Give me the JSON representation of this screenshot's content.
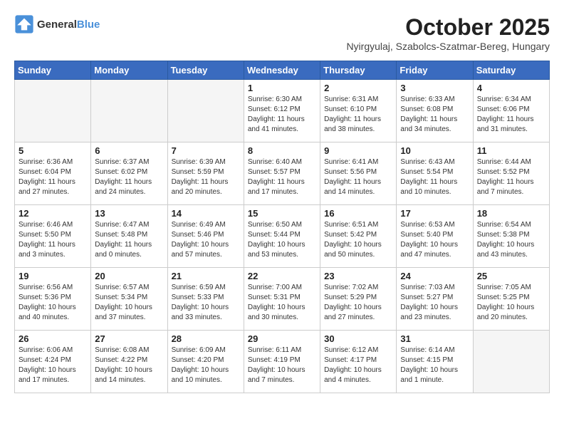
{
  "header": {
    "logo_line1": "General",
    "logo_line2": "Blue",
    "month_title": "October 2025",
    "subtitle": "Nyirgyulaj, Szabolcs-Szatmar-Bereg, Hungary"
  },
  "weekdays": [
    "Sunday",
    "Monday",
    "Tuesday",
    "Wednesday",
    "Thursday",
    "Friday",
    "Saturday"
  ],
  "weeks": [
    [
      {
        "day": "",
        "info": ""
      },
      {
        "day": "",
        "info": ""
      },
      {
        "day": "",
        "info": ""
      },
      {
        "day": "1",
        "info": "Sunrise: 6:30 AM\nSunset: 6:12 PM\nDaylight: 11 hours\nand 41 minutes."
      },
      {
        "day": "2",
        "info": "Sunrise: 6:31 AM\nSunset: 6:10 PM\nDaylight: 11 hours\nand 38 minutes."
      },
      {
        "day": "3",
        "info": "Sunrise: 6:33 AM\nSunset: 6:08 PM\nDaylight: 11 hours\nand 34 minutes."
      },
      {
        "day": "4",
        "info": "Sunrise: 6:34 AM\nSunset: 6:06 PM\nDaylight: 11 hours\nand 31 minutes."
      }
    ],
    [
      {
        "day": "5",
        "info": "Sunrise: 6:36 AM\nSunset: 6:04 PM\nDaylight: 11 hours\nand 27 minutes."
      },
      {
        "day": "6",
        "info": "Sunrise: 6:37 AM\nSunset: 6:02 PM\nDaylight: 11 hours\nand 24 minutes."
      },
      {
        "day": "7",
        "info": "Sunrise: 6:39 AM\nSunset: 5:59 PM\nDaylight: 11 hours\nand 20 minutes."
      },
      {
        "day": "8",
        "info": "Sunrise: 6:40 AM\nSunset: 5:57 PM\nDaylight: 11 hours\nand 17 minutes."
      },
      {
        "day": "9",
        "info": "Sunrise: 6:41 AM\nSunset: 5:56 PM\nDaylight: 11 hours\nand 14 minutes."
      },
      {
        "day": "10",
        "info": "Sunrise: 6:43 AM\nSunset: 5:54 PM\nDaylight: 11 hours\nand 10 minutes."
      },
      {
        "day": "11",
        "info": "Sunrise: 6:44 AM\nSunset: 5:52 PM\nDaylight: 11 hours\nand 7 minutes."
      }
    ],
    [
      {
        "day": "12",
        "info": "Sunrise: 6:46 AM\nSunset: 5:50 PM\nDaylight: 11 hours\nand 3 minutes."
      },
      {
        "day": "13",
        "info": "Sunrise: 6:47 AM\nSunset: 5:48 PM\nDaylight: 11 hours\nand 0 minutes."
      },
      {
        "day": "14",
        "info": "Sunrise: 6:49 AM\nSunset: 5:46 PM\nDaylight: 10 hours\nand 57 minutes."
      },
      {
        "day": "15",
        "info": "Sunrise: 6:50 AM\nSunset: 5:44 PM\nDaylight: 10 hours\nand 53 minutes."
      },
      {
        "day": "16",
        "info": "Sunrise: 6:51 AM\nSunset: 5:42 PM\nDaylight: 10 hours\nand 50 minutes."
      },
      {
        "day": "17",
        "info": "Sunrise: 6:53 AM\nSunset: 5:40 PM\nDaylight: 10 hours\nand 47 minutes."
      },
      {
        "day": "18",
        "info": "Sunrise: 6:54 AM\nSunset: 5:38 PM\nDaylight: 10 hours\nand 43 minutes."
      }
    ],
    [
      {
        "day": "19",
        "info": "Sunrise: 6:56 AM\nSunset: 5:36 PM\nDaylight: 10 hours\nand 40 minutes."
      },
      {
        "day": "20",
        "info": "Sunrise: 6:57 AM\nSunset: 5:34 PM\nDaylight: 10 hours\nand 37 minutes."
      },
      {
        "day": "21",
        "info": "Sunrise: 6:59 AM\nSunset: 5:33 PM\nDaylight: 10 hours\nand 33 minutes."
      },
      {
        "day": "22",
        "info": "Sunrise: 7:00 AM\nSunset: 5:31 PM\nDaylight: 10 hours\nand 30 minutes."
      },
      {
        "day": "23",
        "info": "Sunrise: 7:02 AM\nSunset: 5:29 PM\nDaylight: 10 hours\nand 27 minutes."
      },
      {
        "day": "24",
        "info": "Sunrise: 7:03 AM\nSunset: 5:27 PM\nDaylight: 10 hours\nand 23 minutes."
      },
      {
        "day": "25",
        "info": "Sunrise: 7:05 AM\nSunset: 5:25 PM\nDaylight: 10 hours\nand 20 minutes."
      }
    ],
    [
      {
        "day": "26",
        "info": "Sunrise: 6:06 AM\nSunset: 4:24 PM\nDaylight: 10 hours\nand 17 minutes."
      },
      {
        "day": "27",
        "info": "Sunrise: 6:08 AM\nSunset: 4:22 PM\nDaylight: 10 hours\nand 14 minutes."
      },
      {
        "day": "28",
        "info": "Sunrise: 6:09 AM\nSunset: 4:20 PM\nDaylight: 10 hours\nand 10 minutes."
      },
      {
        "day": "29",
        "info": "Sunrise: 6:11 AM\nSunset: 4:19 PM\nDaylight: 10 hours\nand 7 minutes."
      },
      {
        "day": "30",
        "info": "Sunrise: 6:12 AM\nSunset: 4:17 PM\nDaylight: 10 hours\nand 4 minutes."
      },
      {
        "day": "31",
        "info": "Sunrise: 6:14 AM\nSunset: 4:15 PM\nDaylight: 10 hours\nand 1 minute."
      },
      {
        "day": "",
        "info": ""
      }
    ]
  ]
}
